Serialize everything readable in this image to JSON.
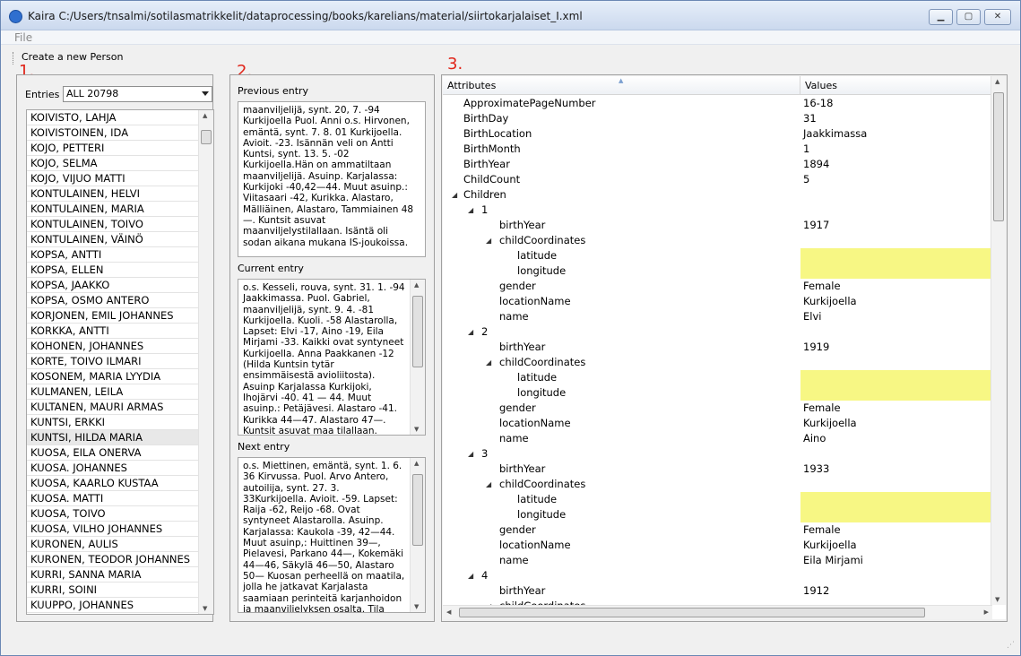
{
  "window": {
    "title": "Kaira C:/Users/tnsalmi/sotilasmatrikkelit/dataprocessing/books/karelians/material/siirtokarjalaiset_I.xml",
    "min": "▁",
    "max": "▢",
    "close": "✕"
  },
  "menu": {
    "file": "File"
  },
  "toolbar": {
    "create": "Create a  new Person"
  },
  "sections": {
    "one": "1.",
    "two": "2.",
    "three": "3."
  },
  "entries": {
    "label": "Entries",
    "selected": "ALL 20798",
    "names": [
      "KOIVISTO, LAHJA",
      "KOIVISTOINEN, IDA",
      "KOJO, PETTERI",
      "KOJO, SELMA",
      "KOJO, VIJUO MATTI",
      "KONTULAINEN, HELVI",
      "KONTULAINEN, MARIA",
      "KONTULAINEN, TOIVO",
      "KONTULAINEN, VÄINÖ",
      "KOPSA, ANTTI",
      "KOPSA, ELLEN",
      "KOPSA, JAAKKO",
      "KOPSA, OSMO ANTERO",
      "KORJONEN, EMIL JOHANNES",
      "KORKKA, ANTTI",
      "KOHONEN, JOHANNES",
      "KORTE, TOIVO ILMARI",
      "KOSONEM, MARIA LYYDIA",
      "KULMANEN, LEILA",
      "KULTANEN, MAURI ARMAS",
      "KUNTSI, ERKKI",
      "KUNTSI, HILDA MARIA",
      "KUOSA, EILA ONERVA",
      "KUOSA. JOHANNES",
      "KUOSA, KAARLO KUSTAA",
      "KUOSA. MATTI",
      "KUOSA, TOIVO",
      "KUOSA, VILHO JOHANNES",
      "KURONEN, AULIS",
      "KURONEN, TEODOR JOHANNES",
      "KURRI, SANNA MARIA",
      "KURRI, SOINI",
      "KUUPPO, JOHANNES"
    ],
    "selected_index": 21
  },
  "previous": {
    "label": "Previous entry",
    "text": "maanviljelijä, synt. 20, 7. -94 Kurkijoella Puol. Anni o.s. Hirvonen, emäntä, synt. 7. 8. 01 Kurkijoella. Avioit. -23. Isännän veli on Antti Kuntsi, synt. 13. 5. -02 Kurkijoella.Hän on ammatiltaan maanviljelijä. Asuinp. Karjalassa: Kurkijoki -40,42—44. Muut asuinp.: Viitasaari -42, Kurikka. Alastaro, Mälliäinen, Alastaro, Tammiainen 48 —. Kuntsit asuvat maanviljelystilallaan. Isäntä oli sodan aikana mukana IS-joukoissa."
  },
  "current": {
    "label": "Current entry",
    "text": "o.s. Kesseli, rouva, synt. 31. 1. -94 Jaakkimassa. Puol. Gabriel, maanviljelijä, synt. 9. 4. -81 Kurkijoella. Kuoli. -58 Alastarolla, Lapset: Elvi -17, Aino -19, Eila Mirjami -33. Kaikki ovat syntyneet Kurkijoella. Anna Paakkanen -12 (Hilda Kuntsin tytär ensimmäisestä avioliitosta). Asuinp Karjalassa Kurkijoki, Ihojärvi -40. 41 — 44. Muut asuinp.: Petäjävesi. Alastaro -41. Kurikka 44—47. Alastaro 47—. Kuntsit asuvat maa tilallaan. Kaikki"
  },
  "next": {
    "label": "Next entry",
    "text": "o.s. Miettinen, emäntä, synt. 1. 6. 36 Kirvussa. Puol. Arvo Antero, autoilija, synt. 27. 3.   33Kurkijoella. Avioit. -59. Lapset: Raija -62, Reijo -68. Ovat syntyneet Alastarolla. Asuinp. Karjalassa: Kaukola -39, 42—44. Muut asuinp,: Huittinen 39—, Pielavesi, Parkano 44—, Kokemäki 44—46, Säkylä 46—50, Alastaro 50— Kuosan perheellä on maatila, jolla he jatkavat Karjalasta saamiaan perinteitä karjanhoidon ja maanviljelyksen osalta. Tila sijaitsee"
  },
  "tree": {
    "col_attr": "Attributes",
    "col_vals": "Values",
    "rows": [
      {
        "a": "ApproximatePageNumber",
        "v": "16-18"
      },
      {
        "a": "BirthDay",
        "v": "31"
      },
      {
        "a": "BirthLocation",
        "v": "Jaakkimassa"
      },
      {
        "a": "BirthMonth",
        "v": "1"
      },
      {
        "a": "BirthYear",
        "v": "1894"
      },
      {
        "a": "ChildCount",
        "v": "5"
      },
      {
        "a": "Children",
        "v": ""
      },
      {
        "a": "1",
        "v": ""
      },
      {
        "a": "birthYear",
        "v": "1917"
      },
      {
        "a": "childCoordinates",
        "v": ""
      },
      {
        "a": "latitude",
        "v": ""
      },
      {
        "a": "longitude",
        "v": ""
      },
      {
        "a": "gender",
        "v": "Female"
      },
      {
        "a": "locationName",
        "v": "Kurkijoella"
      },
      {
        "a": "name",
        "v": "Elvi"
      },
      {
        "a": "2",
        "v": ""
      },
      {
        "a": "birthYear",
        "v": "1919"
      },
      {
        "a": "childCoordinates",
        "v": ""
      },
      {
        "a": "latitude",
        "v": ""
      },
      {
        "a": "longitude",
        "v": ""
      },
      {
        "a": "gender",
        "v": "Female"
      },
      {
        "a": "locationName",
        "v": "Kurkijoella"
      },
      {
        "a": "name",
        "v": "Aino"
      },
      {
        "a": "3",
        "v": ""
      },
      {
        "a": "birthYear",
        "v": "1933"
      },
      {
        "a": "childCoordinates",
        "v": ""
      },
      {
        "a": "latitude",
        "v": ""
      },
      {
        "a": "longitude",
        "v": ""
      },
      {
        "a": "gender",
        "v": "Female"
      },
      {
        "a": "locationName",
        "v": "Kurkijoella"
      },
      {
        "a": "name",
        "v": "Eila Mirjami"
      },
      {
        "a": "4",
        "v": ""
      },
      {
        "a": "birthYear",
        "v": "1912"
      },
      {
        "a": "childCoordinates",
        "v": ""
      }
    ]
  },
  "colors": {
    "highlight": "#f7f784",
    "section_number": "#e0251a",
    "titlebar": "#dbe6f4"
  }
}
